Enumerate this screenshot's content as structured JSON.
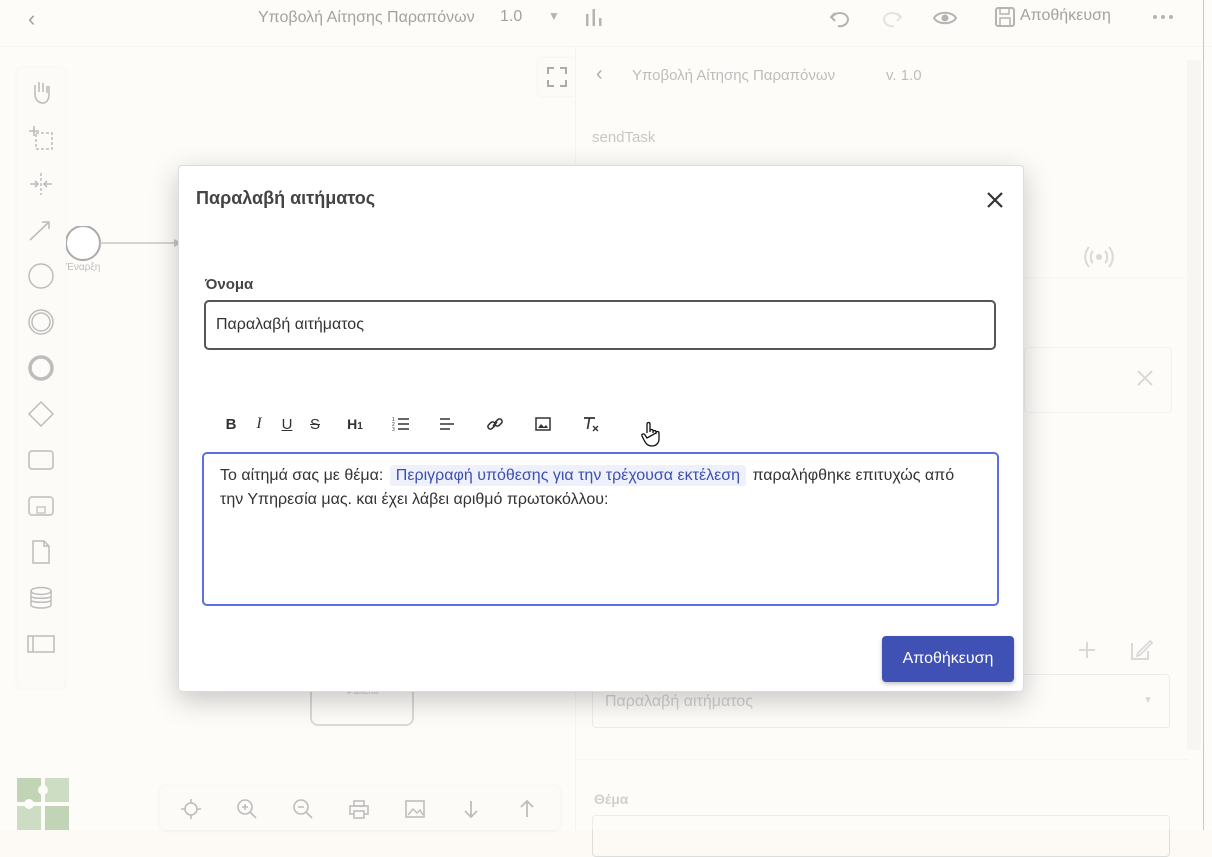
{
  "topbar": {
    "title": "Υποβολή Αίτησης Παραπόνων",
    "version": "1.0",
    "save_label": "Αποθήκευση"
  },
  "canvas": {
    "start_event_label": "Έναρξη",
    "task_label": "Φάκελο"
  },
  "right_panel": {
    "title": "Υποβολή Αίτησης Παραπόνων",
    "version": "v. 1.0",
    "element_type": "sendTask",
    "select_value": "Παραλαβή αιτήματος",
    "subject_label": "Θέμα"
  },
  "modal": {
    "title": "Παραλαβή αιτήματος",
    "name_label": "Όνομα",
    "name_value": "Παραλαβή αιτήματος",
    "editor": {
      "text_before": "Το αίτημά σας με θέμα:",
      "chip": "Περιγραφή υπόθεσης για την τρέχουσα εκτέλεση",
      "text_after": "παραλήφθηκε επιτυχώς από την Υπηρεσία μας. και έχει λάβει αριθμό πρωτοκόλλου:"
    },
    "toolbar": [
      "bold",
      "italic",
      "underline",
      "strikethrough",
      "heading-1",
      "ordered-list",
      "align-left",
      "link",
      "image",
      "clear-format"
    ],
    "save_label": "Αποθήκευση"
  }
}
